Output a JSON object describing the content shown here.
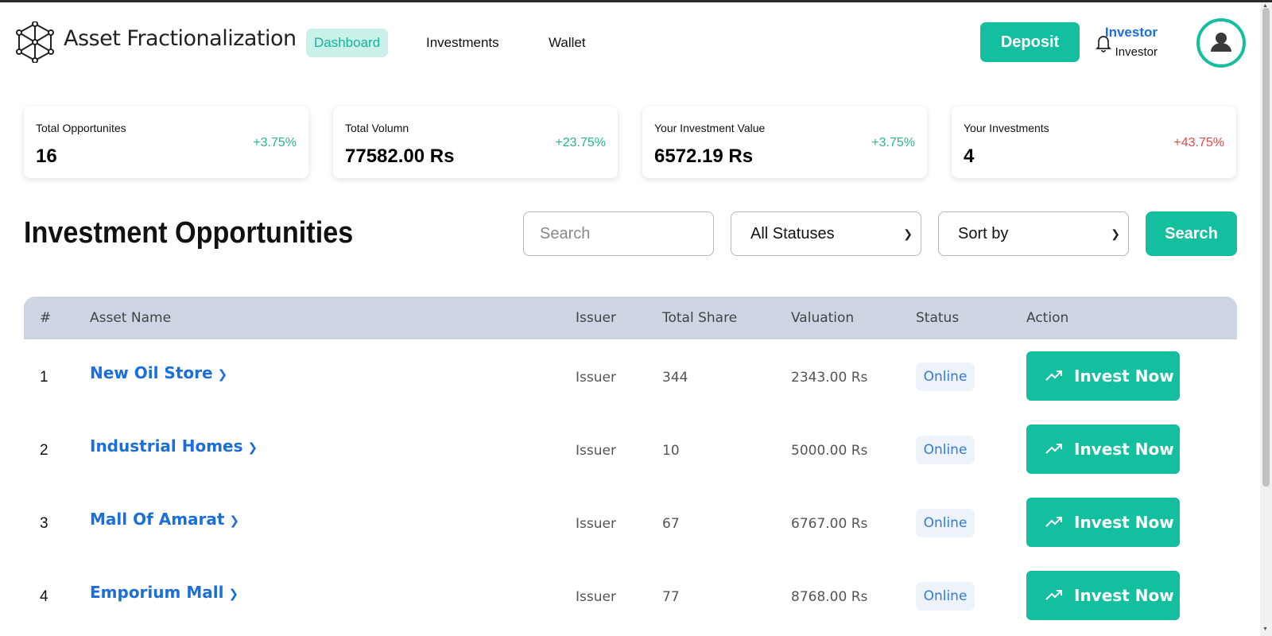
{
  "header": {
    "brand": "Asset Fractionalization",
    "nav": [
      {
        "label": "Dashboard",
        "active": true
      },
      {
        "label": "Investments",
        "active": false
      },
      {
        "label": "Wallet",
        "active": false
      }
    ],
    "deposit_label": "Deposit",
    "user": {
      "name": "Investor",
      "role": "Investor"
    },
    "icons": {
      "logo": "network-cube-icon",
      "bell": "bell-icon",
      "avatar": "user-avatar-icon"
    }
  },
  "stats": [
    {
      "label": "Total Opportunites",
      "value": "16",
      "change": "+3.75%",
      "trend": "positive"
    },
    {
      "label": "Total Volumn",
      "value": "77582.00 Rs",
      "change": "+23.75%",
      "trend": "positive"
    },
    {
      "label": "Your Investment Value",
      "value": "6572.19 Rs",
      "change": "+3.75%",
      "trend": "positive"
    },
    {
      "label": "Your Investments",
      "value": "4",
      "change": "+43.75%",
      "trend": "negative"
    }
  ],
  "opportunities": {
    "title": "Investment Opportunities",
    "search": {
      "placeholder": "Search",
      "value": ""
    },
    "status_filter": {
      "selected": "All Statuses"
    },
    "sort_filter": {
      "selected": "Sort by"
    },
    "search_button": "Search"
  },
  "table": {
    "columns": [
      "#",
      "Asset Name",
      "Issuer",
      "Total Share",
      "Valuation",
      "Status",
      "Action"
    ],
    "rows": [
      {
        "index": "1",
        "asset": "New Oil Store",
        "issuer": "Issuer",
        "total_share": "344",
        "valuation": "2343.00 Rs",
        "status": "Online",
        "action": "Invest Now"
      },
      {
        "index": "2",
        "asset": "Industrial Homes",
        "issuer": "Issuer",
        "total_share": "10",
        "valuation": "5000.00 Rs",
        "status": "Online",
        "action": "Invest Now"
      },
      {
        "index": "3",
        "asset": "Mall Of Amarat",
        "issuer": "Issuer",
        "total_share": "67",
        "valuation": "6767.00 Rs",
        "status": "Online",
        "action": "Invest Now"
      },
      {
        "index": "4",
        "asset": "Emporium Mall",
        "issuer": "Issuer",
        "total_share": "77",
        "valuation": "8768.00 Rs",
        "status": "Online",
        "action": "Invest Now"
      }
    ]
  },
  "colors": {
    "accent": "#14bf9f",
    "link": "#1a6fdd",
    "positive": "#29b58f",
    "negative": "#e5494a",
    "table_header": "#cdd6e2"
  }
}
